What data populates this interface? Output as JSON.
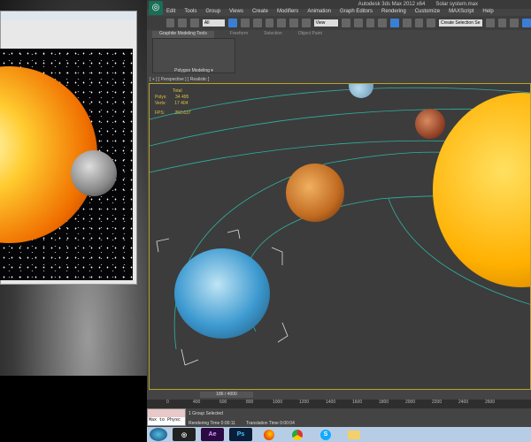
{
  "left_window": {},
  "app": {
    "title": "Autodesk 3ds Max 2012 x64",
    "file": "Solar system.max"
  },
  "menu": [
    "Edit",
    "Tools",
    "Group",
    "Views",
    "Create",
    "Modifiers",
    "Animation",
    "Graph Editors",
    "Rendering",
    "Customize",
    "MAXScript",
    "Help"
  ],
  "toolbar": {
    "filter": "All",
    "coord": "View",
    "selection_set": "Create Selection Se"
  },
  "ribbon": {
    "tabs": [
      "Graphite Modeling Tools",
      "Freeform",
      "Selection",
      "Object Paint"
    ],
    "panel": "Polygon Modeling ▾"
  },
  "viewport": {
    "label": "[ + ] [ Perspective ] [ Realistic ]",
    "stats": {
      "header": "Total",
      "polys_label": "Polys:",
      "polys": "34 495",
      "verts_label": "Verts:",
      "verts": "17 404",
      "fps_label": "FPS:",
      "fps": "250.637"
    }
  },
  "timeline": {
    "position": "186 / 4000",
    "ticks": [
      "0",
      "400",
      "600",
      "800",
      "1000",
      "1200",
      "1400",
      "1600",
      "1800",
      "2000",
      "2200",
      "2400",
      "2600"
    ]
  },
  "status": {
    "maxphys": "Max to Physc",
    "selected": "1 Group Selected",
    "rendering_time": "Rendering Time  0:00:11",
    "translation_time": "Translation Time  0:00:04"
  },
  "taskbar": [
    {
      "icon": "windows-start-icon"
    },
    {
      "icon": "3dsmax-icon"
    },
    {
      "icon": "after-effects-icon",
      "label": "Ae"
    },
    {
      "icon": "photoshop-icon",
      "label": "Ps"
    },
    {
      "icon": "firefox-icon"
    },
    {
      "icon": "chrome-icon"
    },
    {
      "icon": "skype-icon",
      "label": "S"
    },
    {
      "icon": "folder-icon"
    }
  ],
  "colors": {
    "viewport_border": "#b9a325",
    "orbit": "#2fb3a0",
    "accent": "#3a7fd5"
  }
}
